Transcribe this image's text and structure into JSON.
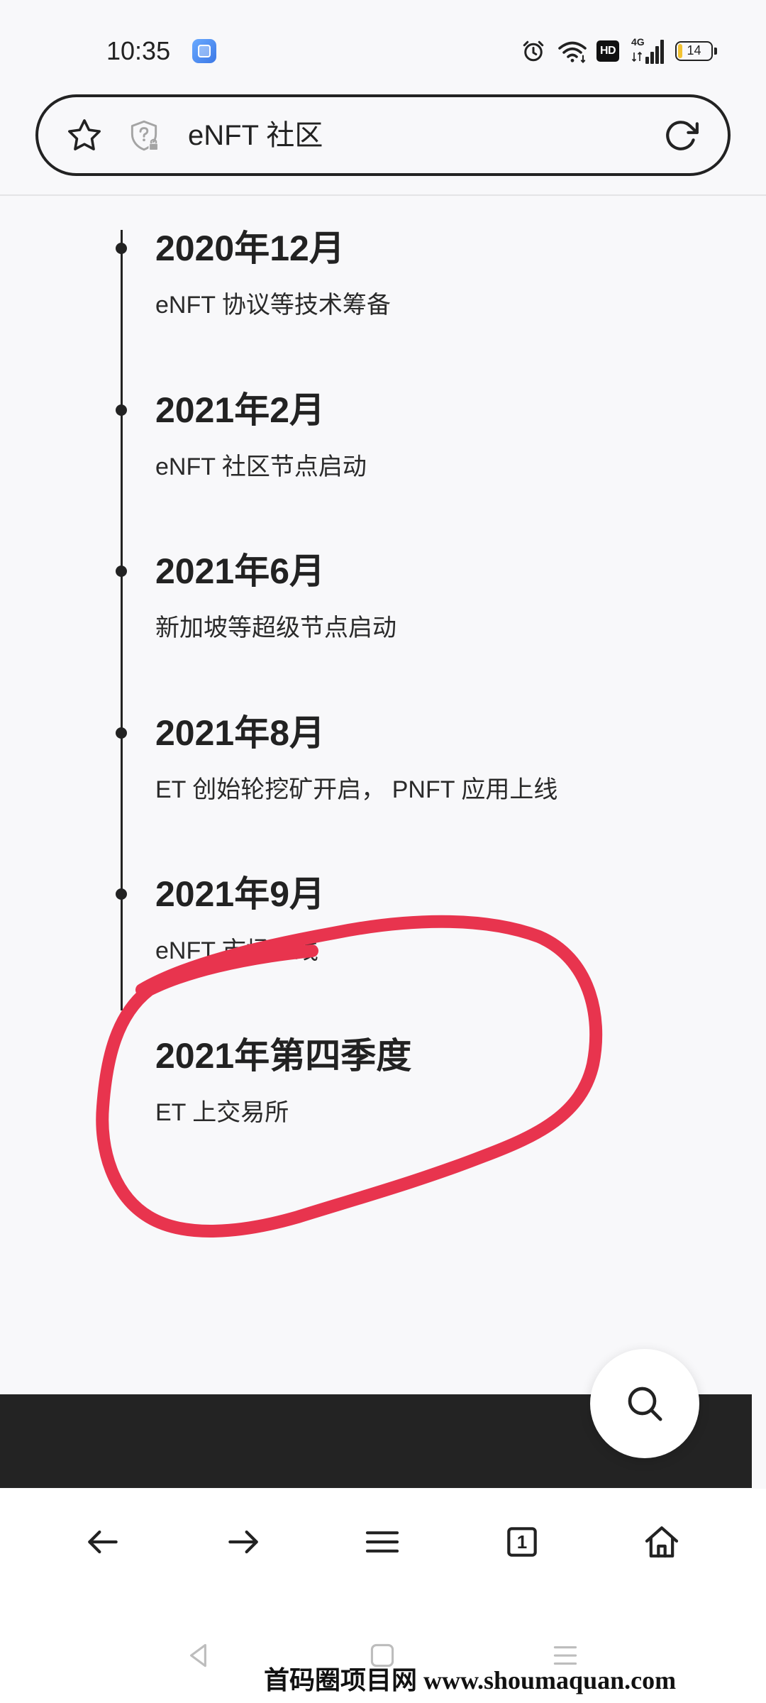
{
  "status_bar": {
    "time": "10:35",
    "hd_badge": "HD",
    "network_type": "4G",
    "battery_percent": "14"
  },
  "address_bar": {
    "page_title": "eNFT 社区"
  },
  "timeline": [
    {
      "date": "2020年12月",
      "desc": "eNFT 协议等技术筹备"
    },
    {
      "date": "2021年2月",
      "desc": "eNFT 社区节点启动"
    },
    {
      "date": "2021年6月",
      "desc": "新加坡等超级节点启动"
    },
    {
      "date": "2021年8月",
      "desc": "ET 创始轮挖矿开启， PNFT 应用上线"
    },
    {
      "date": "2021年9月",
      "desc": "eNFT 市场上线"
    },
    {
      "date": "2021年第四季度",
      "desc": "ET 上交易所"
    }
  ],
  "browser_nav": {
    "tab_count": "1"
  },
  "watermark": "首码圈项目网 www.shoumaquan.com",
  "icons": {
    "status_bar": [
      "app-icon",
      "alarm-icon",
      "wifi-icon",
      "hd-icon",
      "signal-icon",
      "battery-icon"
    ],
    "address_bar": [
      "star-icon",
      "shield-question-icon",
      "refresh-icon"
    ],
    "floating_button": "search-icon",
    "browser_nav": [
      "back-arrow-icon",
      "forward-arrow-icon",
      "menu-icon",
      "tabs-icon",
      "home-icon"
    ],
    "system_nav": [
      "system-back-icon",
      "system-home-icon",
      "system-recents-icon"
    ]
  },
  "colors": {
    "background": "#f8f8fa",
    "text": "#222222",
    "annotation_red": "#e8344e",
    "dark_band": "#232323",
    "battery_fill": "#f2c230"
  }
}
